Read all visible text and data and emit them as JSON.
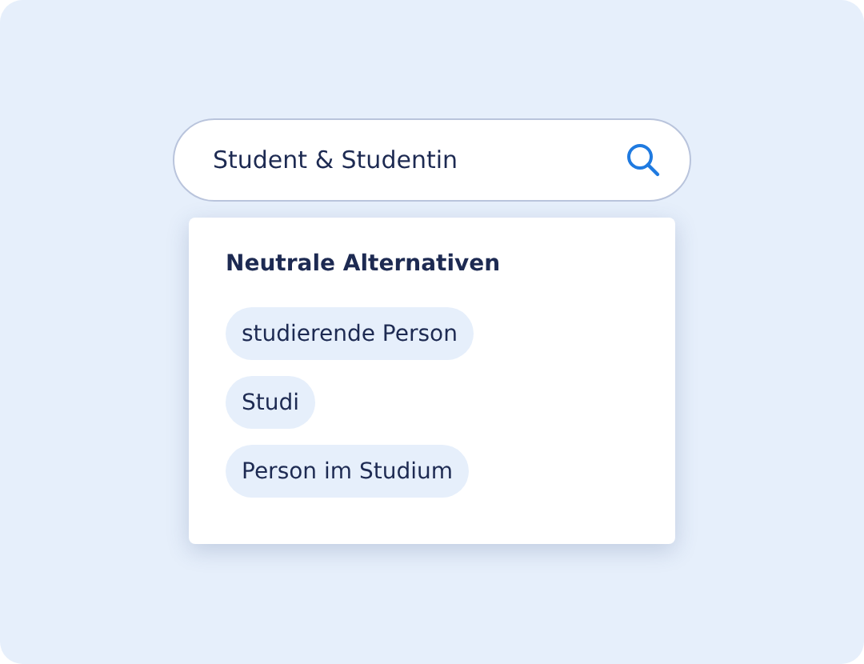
{
  "search": {
    "value": "Student & Studentin"
  },
  "suggestions": {
    "heading": "Neutrale Alternativen",
    "items": [
      "studierende Person",
      "Studi",
      "Person im Studium"
    ]
  }
}
